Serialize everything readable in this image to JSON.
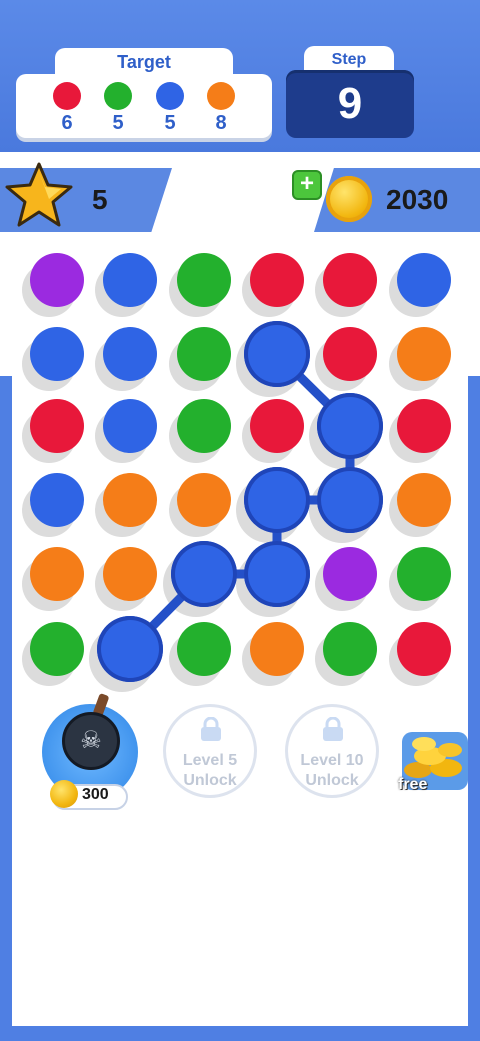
{
  "header": {
    "target_title": "Target",
    "targets": [
      {
        "color": "#e8183a",
        "count": "6"
      },
      {
        "color": "#23b02d",
        "count": "5"
      },
      {
        "color": "#2f64e5",
        "count": "5"
      },
      {
        "color": "#f57d18",
        "count": "8"
      }
    ],
    "step_label": "Step",
    "step_value": "9"
  },
  "stats": {
    "stars": "5",
    "coins": "2030"
  },
  "colors": {
    "purple": "#9b2ae0",
    "blue": "#2f64e5",
    "green": "#23b02d",
    "red": "#e8183a",
    "orange": "#f57d18"
  },
  "board": {
    "rows": 6,
    "cols": 6,
    "grid": [
      [
        "purple",
        "blue",
        "green",
        "red",
        "red",
        "blue"
      ],
      [
        "blue",
        "blue",
        "green",
        "blue",
        "red",
        "orange"
      ],
      [
        "red",
        "blue",
        "green",
        "red",
        "blue",
        "red"
      ],
      [
        "blue",
        "orange",
        "orange",
        "blue",
        "blue",
        "orange"
      ],
      [
        "orange",
        "orange",
        "blue",
        "blue",
        "purple",
        "green"
      ],
      [
        "green",
        "blue",
        "green",
        "orange",
        "green",
        "red"
      ]
    ],
    "selected_path": [
      [
        5,
        1
      ],
      [
        4,
        2
      ],
      [
        4,
        3
      ],
      [
        3,
        3
      ],
      [
        3,
        4
      ],
      [
        2,
        4
      ],
      [
        1,
        3
      ]
    ]
  },
  "boosters": {
    "bomb_price": "300",
    "lock1_line1": "Level 5",
    "lock1_line2": "Unlock",
    "lock2_line1": "Level 10",
    "lock2_line2": "Unlock",
    "free_label": "free"
  }
}
